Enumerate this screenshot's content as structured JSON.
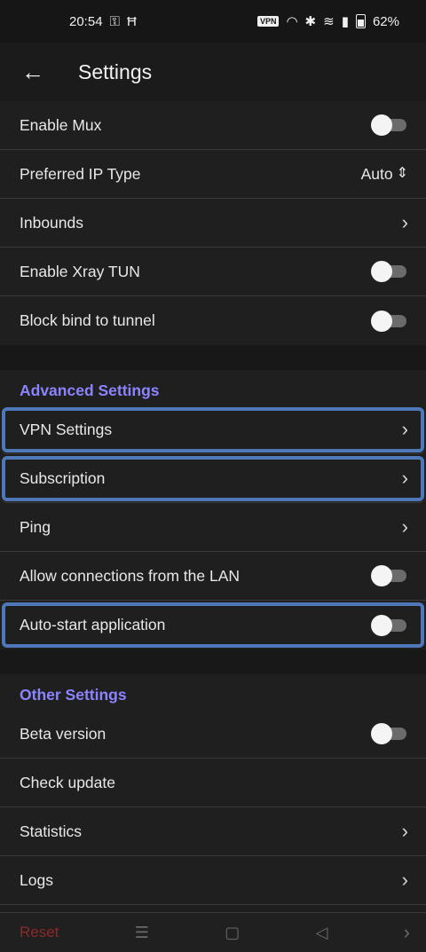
{
  "status": {
    "time": "20:54",
    "key_icon": "key-icon",
    "vpn": "VPN",
    "battery": "62%"
  },
  "appbar": {
    "title": "Settings"
  },
  "group1": [
    {
      "label": "Enable Mux",
      "control": "toggle"
    },
    {
      "label": "Preferred IP Type",
      "control": "value",
      "value": "Auto"
    },
    {
      "label": "Inbounds",
      "control": "chevron"
    },
    {
      "label": "Enable Xray TUN",
      "control": "toggle"
    },
    {
      "label": "Block bind to tunnel",
      "control": "toggle"
    }
  ],
  "advanced": {
    "header": "Advanced Settings",
    "items": [
      {
        "label": "VPN Settings"
      },
      {
        "label": "Subscription"
      },
      {
        "label": "Ping"
      },
      {
        "label": "Allow connections from the LAN"
      },
      {
        "label": "Auto-start application"
      }
    ]
  },
  "other": {
    "header": "Other Settings",
    "items": [
      {
        "label": "Beta version"
      },
      {
        "label": "Check update"
      },
      {
        "label": "Statistics"
      },
      {
        "label": "Logs"
      }
    ]
  },
  "bottom": {
    "reset_label": "Reset"
  }
}
